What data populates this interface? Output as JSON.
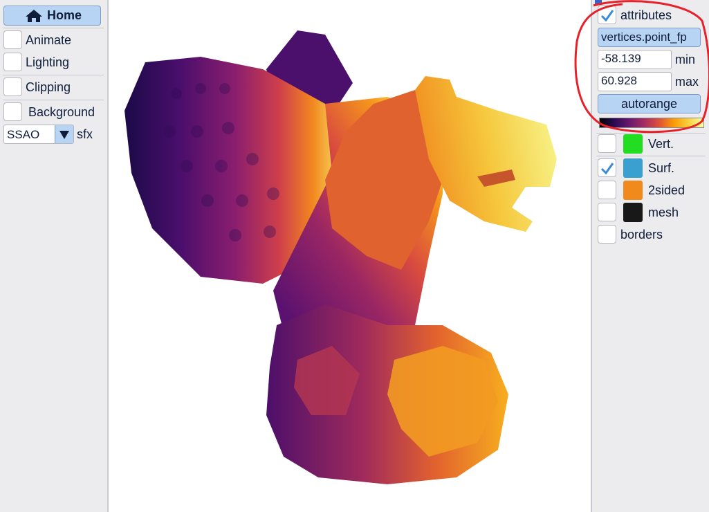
{
  "left_panel": {
    "home_label": "Home",
    "animate_label": "Animate",
    "lighting_label": "Lighting",
    "clipping_label": "Clipping",
    "background_label": "Background",
    "sfx_select_value": "SSAO",
    "sfx_label": "sfx"
  },
  "right_panel": {
    "attributes_label": "attributes",
    "attribute_name": "vertices.point_fp",
    "min_value": "-58.139",
    "min_label": "min",
    "max_value": "60.928",
    "max_label": "max",
    "autorange_label": "autorange",
    "layers": [
      {
        "label": "Vert.",
        "checked": false,
        "color": "#22dd22"
      },
      {
        "label": "Surf.",
        "checked": true,
        "color": "#3aa0d0"
      },
      {
        "label": "2sided",
        "checked": false,
        "color": "#f08a1c"
      },
      {
        "label": "mesh",
        "checked": false,
        "color": "#181818"
      }
    ],
    "borders_label": "borders"
  },
  "colors": {
    "button_fill": "#b8d4f5",
    "annotation_red": "#e8202a",
    "panel_bg": "#ececef"
  }
}
